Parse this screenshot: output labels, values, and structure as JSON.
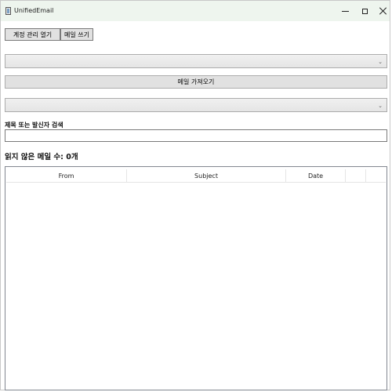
{
  "window": {
    "title": "UnifiedEmail",
    "app_icon": "app-window-icon",
    "controls": [
      "minimize-icon",
      "maximize-icon",
      "close-icon"
    ]
  },
  "toolbar": {
    "account_manager_label": "계정 관리 열기",
    "compose_label": "메일 쓰기"
  },
  "account_combo": {
    "value": "",
    "arrow": "⌄"
  },
  "fetch_button": {
    "label": "메일 가져오기"
  },
  "folder_combo": {
    "value": "",
    "arrow": "⌄"
  },
  "search": {
    "label": "제목 또는 발신자 검색",
    "value": "",
    "placeholder": ""
  },
  "unread": {
    "label": "읽지 않은 메일 수: 0개"
  },
  "mail_table": {
    "columns": [
      "From",
      "Subject",
      "Date",
      ""
    ],
    "rows": []
  },
  "colors": {
    "titlebar": "#eef5ee",
    "button_bg": "#e1e1e1",
    "button_border": "#adadad"
  }
}
